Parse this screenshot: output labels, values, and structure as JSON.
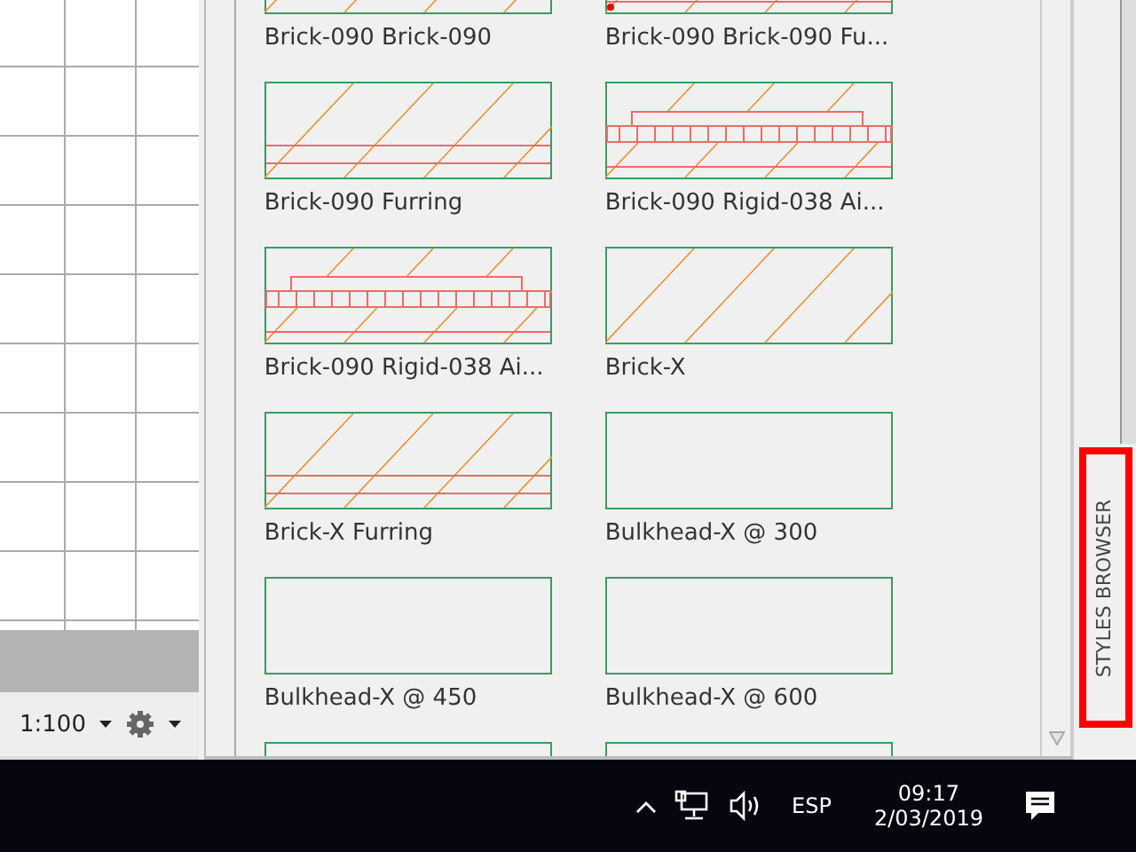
{
  "status_bar": {
    "scale": "1:100"
  },
  "styles_browser": {
    "tiles": [
      {
        "label": "Brick-090 Brick-090",
        "kind": "hatch"
      },
      {
        "label": "Brick-090 Brick-090 Fu...",
        "kind": "double-furring"
      },
      {
        "label": "Brick-090 Furring",
        "kind": "furring"
      },
      {
        "label": "Brick-090 Rigid-038 Ai...",
        "kind": "rigid"
      },
      {
        "label": "Brick-090 Rigid-038 Ai...",
        "kind": "rigid"
      },
      {
        "label": "Brick-X",
        "kind": "hatch"
      },
      {
        "label": "Brick-X Furring",
        "kind": "furring"
      },
      {
        "label": "Bulkhead-X @ 300",
        "kind": "blank"
      },
      {
        "label": "Bulkhead-X @ 450",
        "kind": "blank"
      },
      {
        "label": "Bulkhead-X @ 600",
        "kind": "blank"
      },
      {
        "kind": "blank"
      },
      {
        "kind": "blank"
      }
    ],
    "side_tab": {
      "label": "STYLES BROWSER",
      "highlighted": true
    }
  },
  "taskbar": {
    "language": "ESP",
    "time": "09:17",
    "date": "2/03/2019"
  }
}
